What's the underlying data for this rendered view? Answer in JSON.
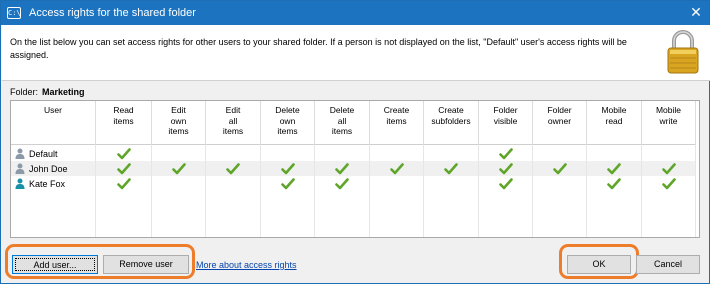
{
  "window": {
    "title": "Access rights for the shared folder",
    "app_icon_text": "C:\\"
  },
  "description": "On the list below you can set access rights for other users to your shared folder. If a person is not displayed on the list, \"Default\" user's access rights will be assigned.",
  "folder": {
    "label": "Folder:",
    "name": "Marketing"
  },
  "columns": [
    {
      "label": "User"
    },
    {
      "label": "Read\nitems"
    },
    {
      "label": "Edit\nown\nitems"
    },
    {
      "label": "Edit\nall\nitems"
    },
    {
      "label": "Delete\nown\nitems"
    },
    {
      "label": "Delete\nall\nitems"
    },
    {
      "label": "Create\nitems"
    },
    {
      "label": "Create\nsubfolders"
    },
    {
      "label": "Folder\nvisible"
    },
    {
      "label": "Folder\nowner"
    },
    {
      "label": "Mobile\nread"
    },
    {
      "label": "Mobile\nwrite"
    }
  ],
  "users": [
    {
      "name": "Default",
      "icon": "user-gray-icon",
      "rights": [
        true,
        false,
        false,
        false,
        false,
        false,
        false,
        true,
        false,
        false,
        false
      ]
    },
    {
      "name": "John Doe",
      "icon": "user-gray-icon",
      "rights": [
        true,
        true,
        true,
        true,
        true,
        true,
        true,
        true,
        true,
        true,
        true
      ]
    },
    {
      "name": "Kate Fox",
      "icon": "user-teal-icon",
      "rights": [
        true,
        false,
        false,
        true,
        true,
        false,
        false,
        true,
        false,
        true,
        true
      ]
    }
  ],
  "buttons": {
    "add_user": "Add user...",
    "remove_user": "Remove user",
    "ok": "OK",
    "cancel": "Cancel"
  },
  "links": {
    "more_about": "More about access rights"
  },
  "colors": {
    "titlebar": "#1c74c0",
    "check": "#5fa52a",
    "highlight": "#ee7d2b",
    "link": "#0645ad"
  }
}
